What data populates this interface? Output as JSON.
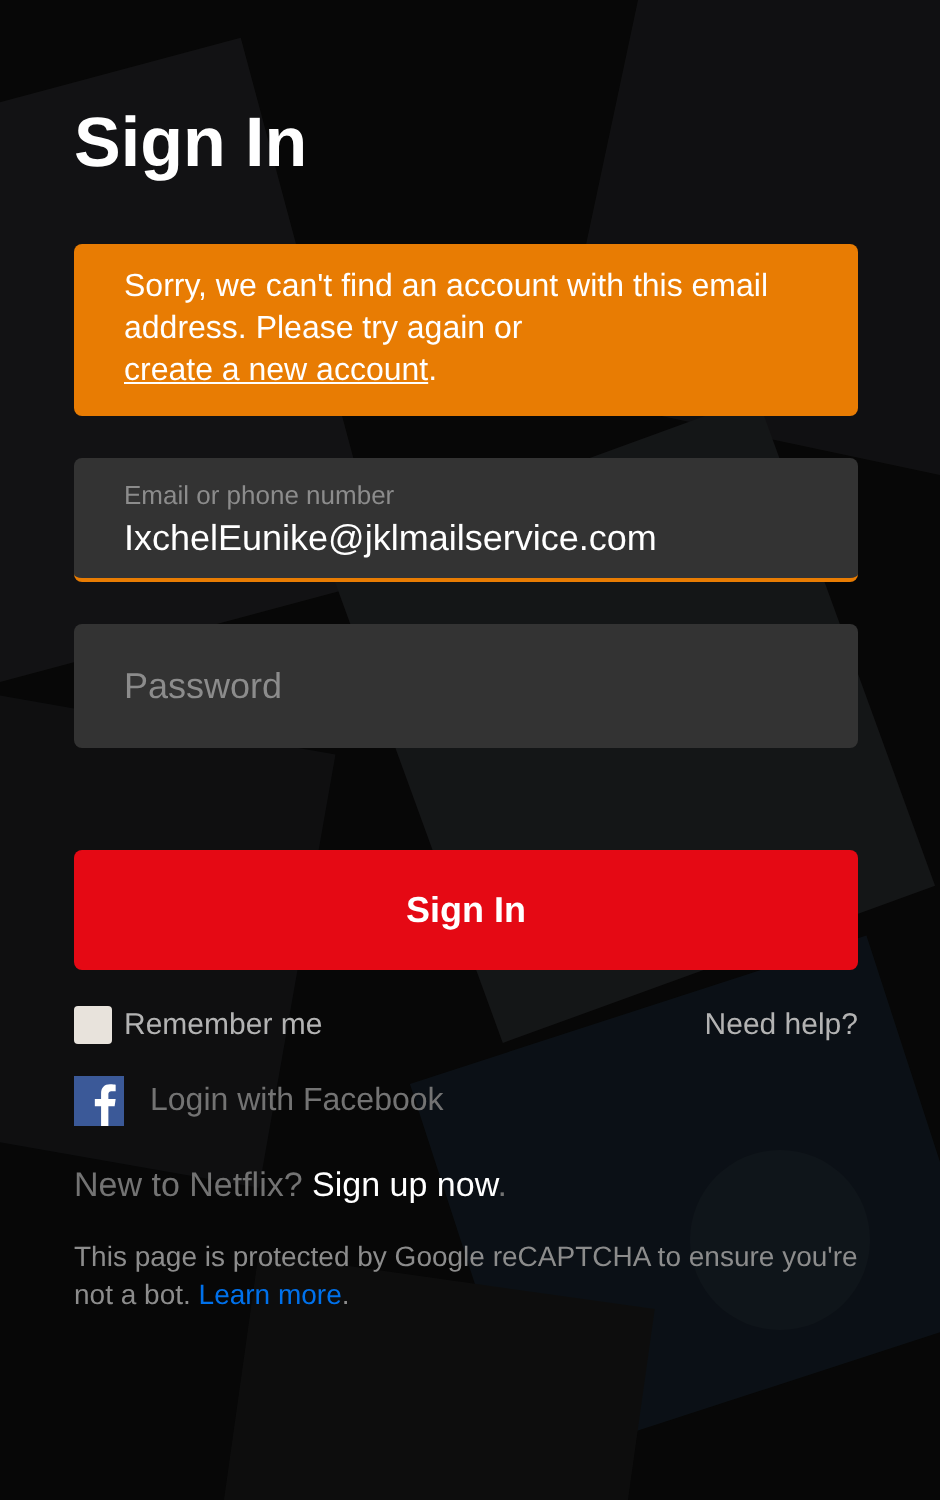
{
  "title": "Sign In",
  "alert": {
    "text": "Sorry, we can't find an account with this email address. Please try again or ",
    "link": "create a new account",
    "end": "."
  },
  "email": {
    "label": "Email or phone number",
    "value": "IxchelEunike@jklmailservice.com",
    "error": true
  },
  "password": {
    "placeholder": "Password"
  },
  "submit": "Sign In",
  "remember": {
    "label": "Remember me",
    "checked": false
  },
  "help": "Need help?",
  "facebook": "Login with Facebook",
  "signup": {
    "text": "New to Netflix? ",
    "link": "Sign up now",
    "end": "."
  },
  "recaptcha": {
    "text": "This page is protected by Google reCAPTCHA to ensure you're not a bot. ",
    "link": "Learn more",
    "end": "."
  }
}
